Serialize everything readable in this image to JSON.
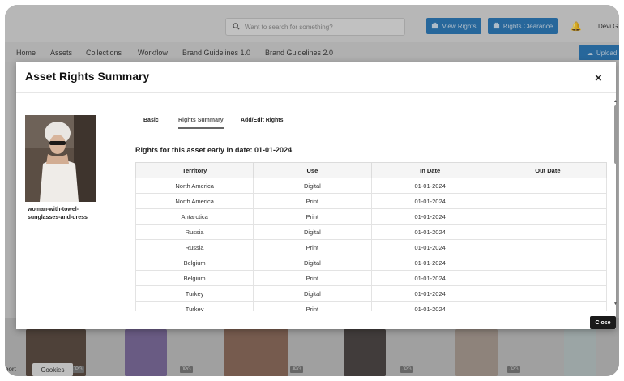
{
  "header": {
    "search_placeholder": "Want to search for something?",
    "view_rights_label": "View Rights",
    "rights_clearance_label": "Rights Clearance",
    "user_name": "Devi G"
  },
  "nav": {
    "items": [
      "Home",
      "Assets",
      "Collections",
      "Workflow",
      "Brand Guidelines 1.0",
      "Brand Guidelines 2.0"
    ],
    "upload_label": "Upload"
  },
  "background": {
    "jpg_badge": "JPG",
    "cookies_label": "Cookies",
    "port_fragment": "port"
  },
  "modal": {
    "title": "Asset Rights Summary",
    "close_glyph": "×",
    "asset_name": "woman-with-towel-sunglasses-and-dress",
    "tabs": [
      "Basic",
      "Rights Summary",
      "Add/Edit Rights"
    ],
    "active_tab": "Rights Summary",
    "rights_heading": "Rights for this asset early in date: 01-01-2024",
    "columns": [
      "Territory",
      "Use",
      "In Date",
      "Out Date"
    ],
    "rows": [
      [
        "North America",
        "Digital",
        "01-01-2024",
        ""
      ],
      [
        "North America",
        "Print",
        "01-01-2024",
        ""
      ],
      [
        "Antarctica",
        "Print",
        "01-01-2024",
        ""
      ],
      [
        "Russia",
        "Digital",
        "01-01-2024",
        ""
      ],
      [
        "Russia",
        "Print",
        "01-01-2024",
        ""
      ],
      [
        "Belgium",
        "Digital",
        "01-01-2024",
        ""
      ],
      [
        "Belgium",
        "Print",
        "01-01-2024",
        ""
      ],
      [
        "Turkey",
        "Digital",
        "01-01-2024",
        ""
      ],
      [
        "Turkey",
        "Print",
        "01-01-2024",
        ""
      ]
    ],
    "close_button_label": "Close"
  },
  "colors": {
    "accent": "#2a78b8",
    "close_button": "#1a1a1a"
  }
}
